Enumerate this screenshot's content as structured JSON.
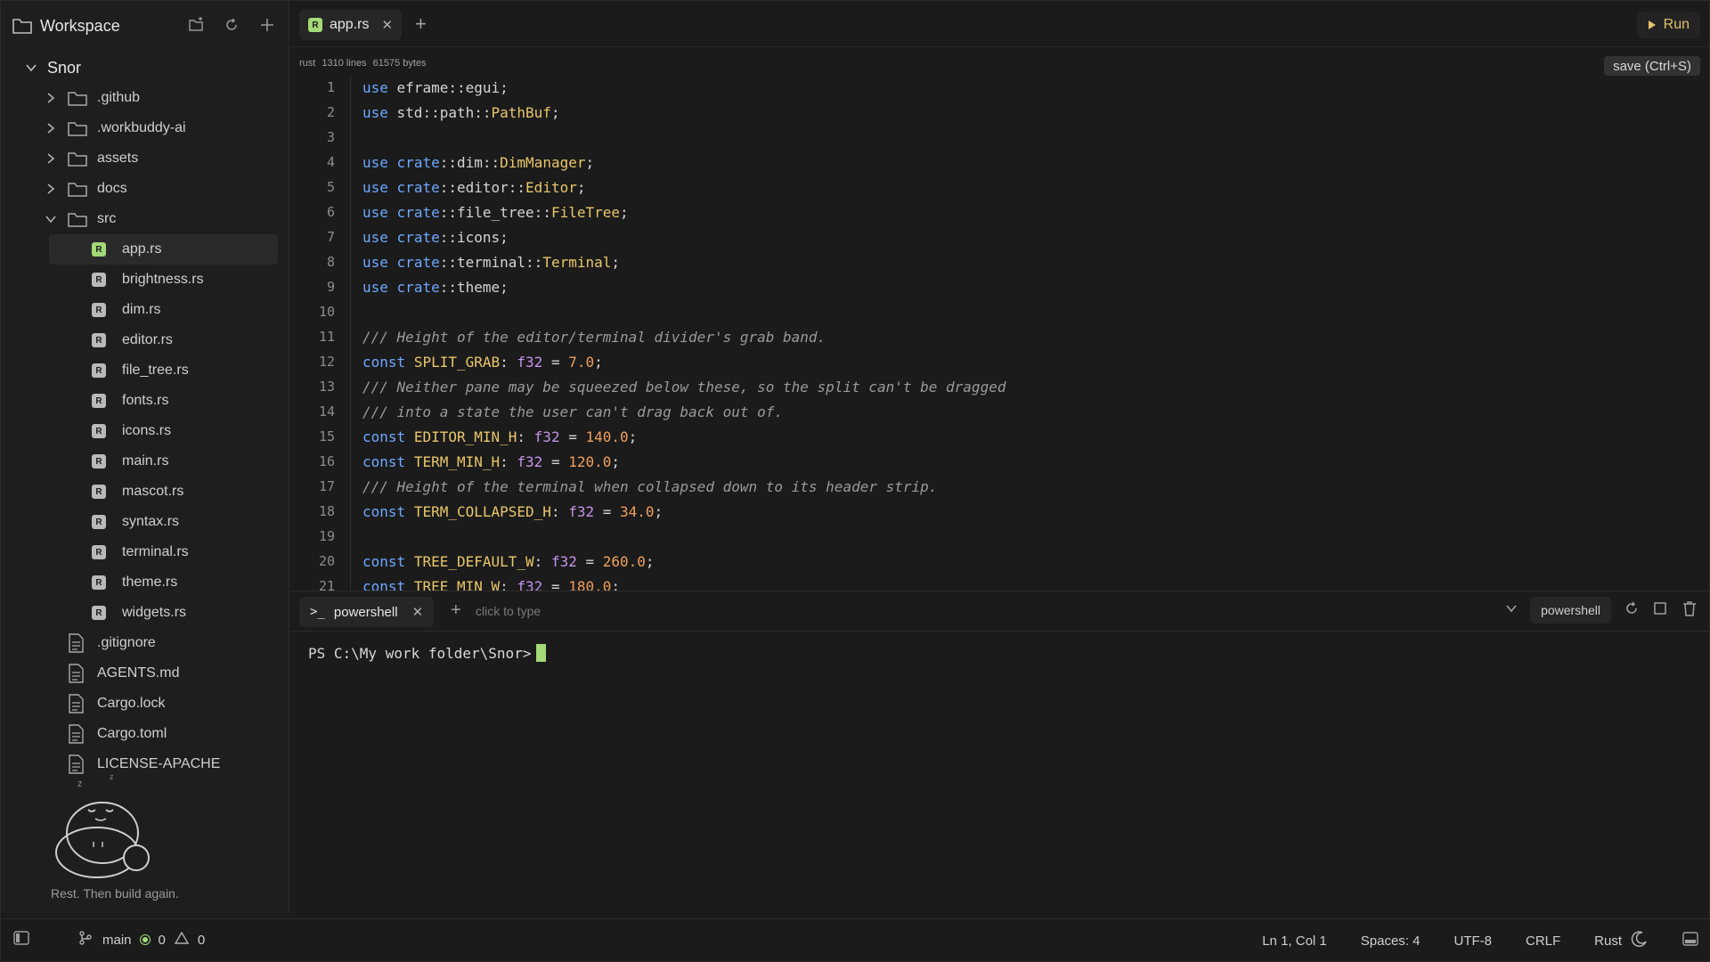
{
  "workspace": {
    "title": "Workspace",
    "project": "Snor",
    "items": [
      {
        "type": "folder",
        "label": ".github",
        "open": false
      },
      {
        "type": "folder",
        "label": ".workbuddy-ai",
        "open": false
      },
      {
        "type": "folder",
        "label": "assets",
        "open": false
      },
      {
        "type": "folder",
        "label": "docs",
        "open": false
      },
      {
        "type": "folder",
        "label": "src",
        "open": true
      },
      {
        "type": "rs",
        "label": "app.rs",
        "active": true
      },
      {
        "type": "rs",
        "label": "brightness.rs"
      },
      {
        "type": "rs",
        "label": "dim.rs"
      },
      {
        "type": "rs",
        "label": "editor.rs"
      },
      {
        "type": "rs",
        "label": "file_tree.rs"
      },
      {
        "type": "rs",
        "label": "fonts.rs"
      },
      {
        "type": "rs",
        "label": "icons.rs"
      },
      {
        "type": "rs",
        "label": "main.rs"
      },
      {
        "type": "rs",
        "label": "mascot.rs"
      },
      {
        "type": "rs",
        "label": "syntax.rs"
      },
      {
        "type": "rs",
        "label": "terminal.rs"
      },
      {
        "type": "rs",
        "label": "theme.rs"
      },
      {
        "type": "rs",
        "label": "widgets.rs"
      },
      {
        "type": "file",
        "label": ".gitignore"
      },
      {
        "type": "file",
        "label": "AGENTS.md"
      },
      {
        "type": "file",
        "label": "Cargo.lock"
      },
      {
        "type": "file",
        "label": "Cargo.toml"
      },
      {
        "type": "file",
        "label": "LICENSE-APACHE"
      }
    ],
    "mascot_caption": "Rest. Then build again.",
    "mascot_zz": "z"
  },
  "editor": {
    "tab_label": "app.rs",
    "tab_badge": "R",
    "run_label": "Run",
    "meta_lang": "rust",
    "meta_lines": "1310 lines",
    "meta_bytes": "61575 bytes",
    "save_label": "save (Ctrl+S)"
  },
  "code_lines": [
    {
      "n": "1",
      "html": "<span class=\"kw\">use</span> eframe::egui;"
    },
    {
      "n": "2",
      "html": "<span class=\"kw\">use</span> std::path::<span class=\"ty\">PathBuf</span>;"
    },
    {
      "n": "3",
      "html": ""
    },
    {
      "n": "4",
      "html": "<span class=\"kw\">use</span> <span class=\"kw\">crate</span>::dim::<span class=\"ty\">DimManager</span>;"
    },
    {
      "n": "5",
      "html": "<span class=\"kw\">use</span> <span class=\"kw\">crate</span>::editor::<span class=\"ty\">Editor</span>;"
    },
    {
      "n": "6",
      "html": "<span class=\"kw\">use</span> <span class=\"kw\">crate</span>::file_tree::<span class=\"ty\">FileTree</span>;"
    },
    {
      "n": "7",
      "html": "<span class=\"kw\">use</span> <span class=\"kw\">crate</span>::icons;"
    },
    {
      "n": "8",
      "html": "<span class=\"kw\">use</span> <span class=\"kw\">crate</span>::terminal::<span class=\"ty\">Terminal</span>;"
    },
    {
      "n": "9",
      "html": "<span class=\"kw\">use</span> <span class=\"kw\">crate</span>::theme;"
    },
    {
      "n": "10",
      "html": ""
    },
    {
      "n": "11",
      "html": "<span class=\"cmt\">/// Height of the editor/terminal divider's grab band.</span>"
    },
    {
      "n": "12",
      "html": "<span class=\"kw\">const</span> <span class=\"const\">SPLIT_GRAB</span>: <span class=\"ptype\">f32</span> = <span class=\"num\">7.0</span>;"
    },
    {
      "n": "13",
      "html": "<span class=\"cmt\">/// Neither pane may be squeezed below these, so the split can't be dragged</span>"
    },
    {
      "n": "14",
      "html": "<span class=\"cmt\">/// into a state the user can't drag back out of.</span>"
    },
    {
      "n": "15",
      "html": "<span class=\"kw\">const</span> <span class=\"const\">EDITOR_MIN_H</span>: <span class=\"ptype\">f32</span> = <span class=\"num\">140.0</span>;"
    },
    {
      "n": "16",
      "html": "<span class=\"kw\">const</span> <span class=\"const\">TERM_MIN_H</span>: <span class=\"ptype\">f32</span> = <span class=\"num\">120.0</span>;"
    },
    {
      "n": "17",
      "html": "<span class=\"cmt\">/// Height of the terminal when collapsed down to its header strip.</span>"
    },
    {
      "n": "18",
      "html": "<span class=\"kw\">const</span> <span class=\"const\">TERM_COLLAPSED_H</span>: <span class=\"ptype\">f32</span> = <span class=\"num\">34.0</span>;"
    },
    {
      "n": "19",
      "html": ""
    },
    {
      "n": "20",
      "html": "<span class=\"kw\">const</span> <span class=\"const\">TREE_DEFAULT_W</span>: <span class=\"ptype\">f32</span> = <span class=\"num\">260.0</span>;"
    },
    {
      "n": "21",
      "html": "<span class=\"kw\">const</span> <span class=\"const\">TREE_MIN_W</span>: <span class=\"ptype\">f32</span> = <span class=\"num\">180.0</span>;"
    }
  ],
  "terminal": {
    "tab_prompt": ">_",
    "tab_label": "powershell",
    "hint": "click to type",
    "shell_label": "powershell",
    "prompt_text": "PS C:\\My work folder\\Snor>"
  },
  "status": {
    "branch": "main",
    "errors": "0",
    "warnings": "0",
    "position": "Ln 1, Col 1",
    "spaces": "Spaces: 4",
    "encoding": "UTF-8",
    "eol": "CRLF",
    "language": "Rust"
  },
  "colors": {
    "accent_green": "#a3d977",
    "keyword": "#6ea8fe",
    "type": "#e8c66a",
    "number": "#f0a05a",
    "prim_type": "#c792ea",
    "comment": "#9a9a9a"
  }
}
